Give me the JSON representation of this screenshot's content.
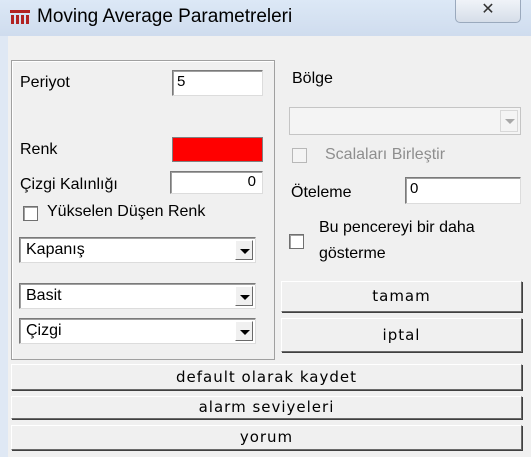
{
  "window": {
    "title": "Moving Average Parametreleri",
    "close_glyph": "✕"
  },
  "left": {
    "periyot_label": "Periyot",
    "periyot_value": "5",
    "renk_label": "Renk",
    "renk_color": "#ff0000",
    "cizgi_kalinligi_label": "Çizgi Kalınlığı",
    "cizgi_kalinligi_value": "0",
    "yukselen_dusen_label": "Yükselen Düşen Renk",
    "combo_kapanis": "Kapanış",
    "combo_basit": "Basit",
    "combo_cizgi": "Çizgi"
  },
  "right": {
    "bolge_label": "Bölge",
    "bolge_value": "",
    "scalalari_label": "Scalaları Birleştir",
    "oteleme_label": "Öteleme",
    "oteleme_value": "0",
    "bu_pencere_line1": "Bu pencereyi bir daha",
    "bu_pencere_line2": "gösterme"
  },
  "buttons": {
    "tamam": "tamam",
    "iptal": "iptal",
    "default": "default olarak kaydet",
    "alarm": "alarm seviyeleri",
    "yorum": "yorum"
  },
  "icons": {
    "app": "app-chart-icon",
    "close": "close-icon",
    "dropdown": "chevron-down-icon"
  }
}
